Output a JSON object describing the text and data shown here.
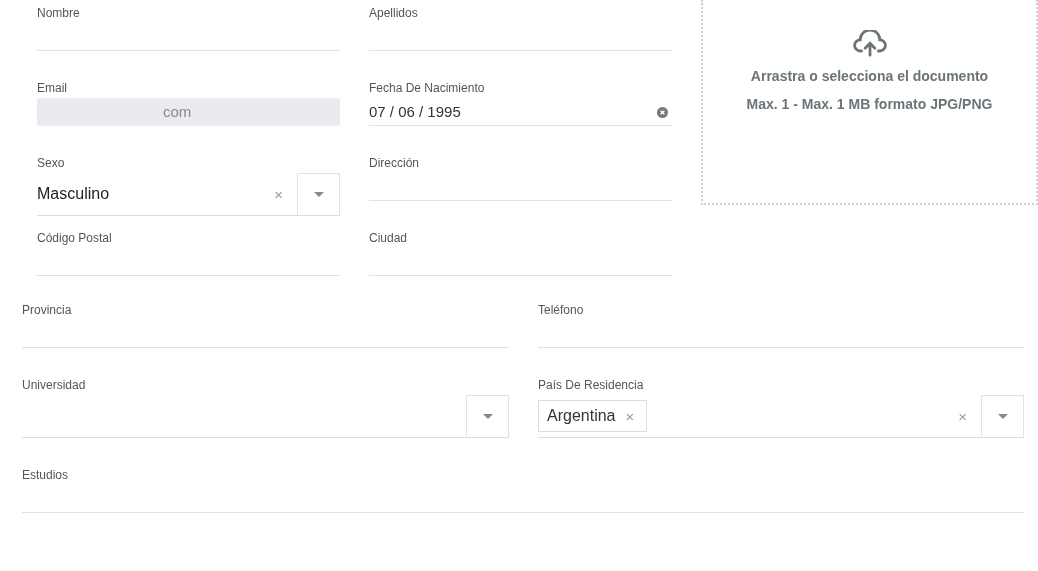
{
  "top_fields": [
    {
      "label": "Nombre",
      "kind": "text"
    },
    {
      "label": "Apellidos",
      "kind": "text"
    },
    {
      "label": "Email",
      "kind": "disabled",
      "value": "com"
    },
    {
      "label": "Fecha De Nacimiento",
      "kind": "date",
      "value": "07 / 06 / 1995",
      "clearable": true
    },
    {
      "label": "Sexo",
      "kind": "select",
      "value": "Masculino",
      "clear_symbol": "×"
    },
    {
      "label": "Dirección",
      "kind": "text"
    },
    {
      "label": "Código Postal",
      "kind": "text"
    },
    {
      "label": "Ciudad",
      "kind": "text"
    }
  ],
  "upload": {
    "title": "Arrastra o selecciona el documento",
    "hint": "Max. 1 - Max. 1 MB formato JPG/PNG"
  },
  "fields": [
    {
      "label": "Provincia",
      "kind": "text"
    },
    {
      "label": "Teléfono",
      "kind": "text"
    },
    {
      "label": "Universidad",
      "kind": "select"
    },
    {
      "label": "País De Residencia",
      "kind": "multiselect",
      "chips": [
        {
          "label": "Argentina",
          "remove_symbol": "×"
        }
      ],
      "clear_symbol": "×"
    },
    {
      "label": "Estudios",
      "kind": "text",
      "wide": true
    }
  ]
}
